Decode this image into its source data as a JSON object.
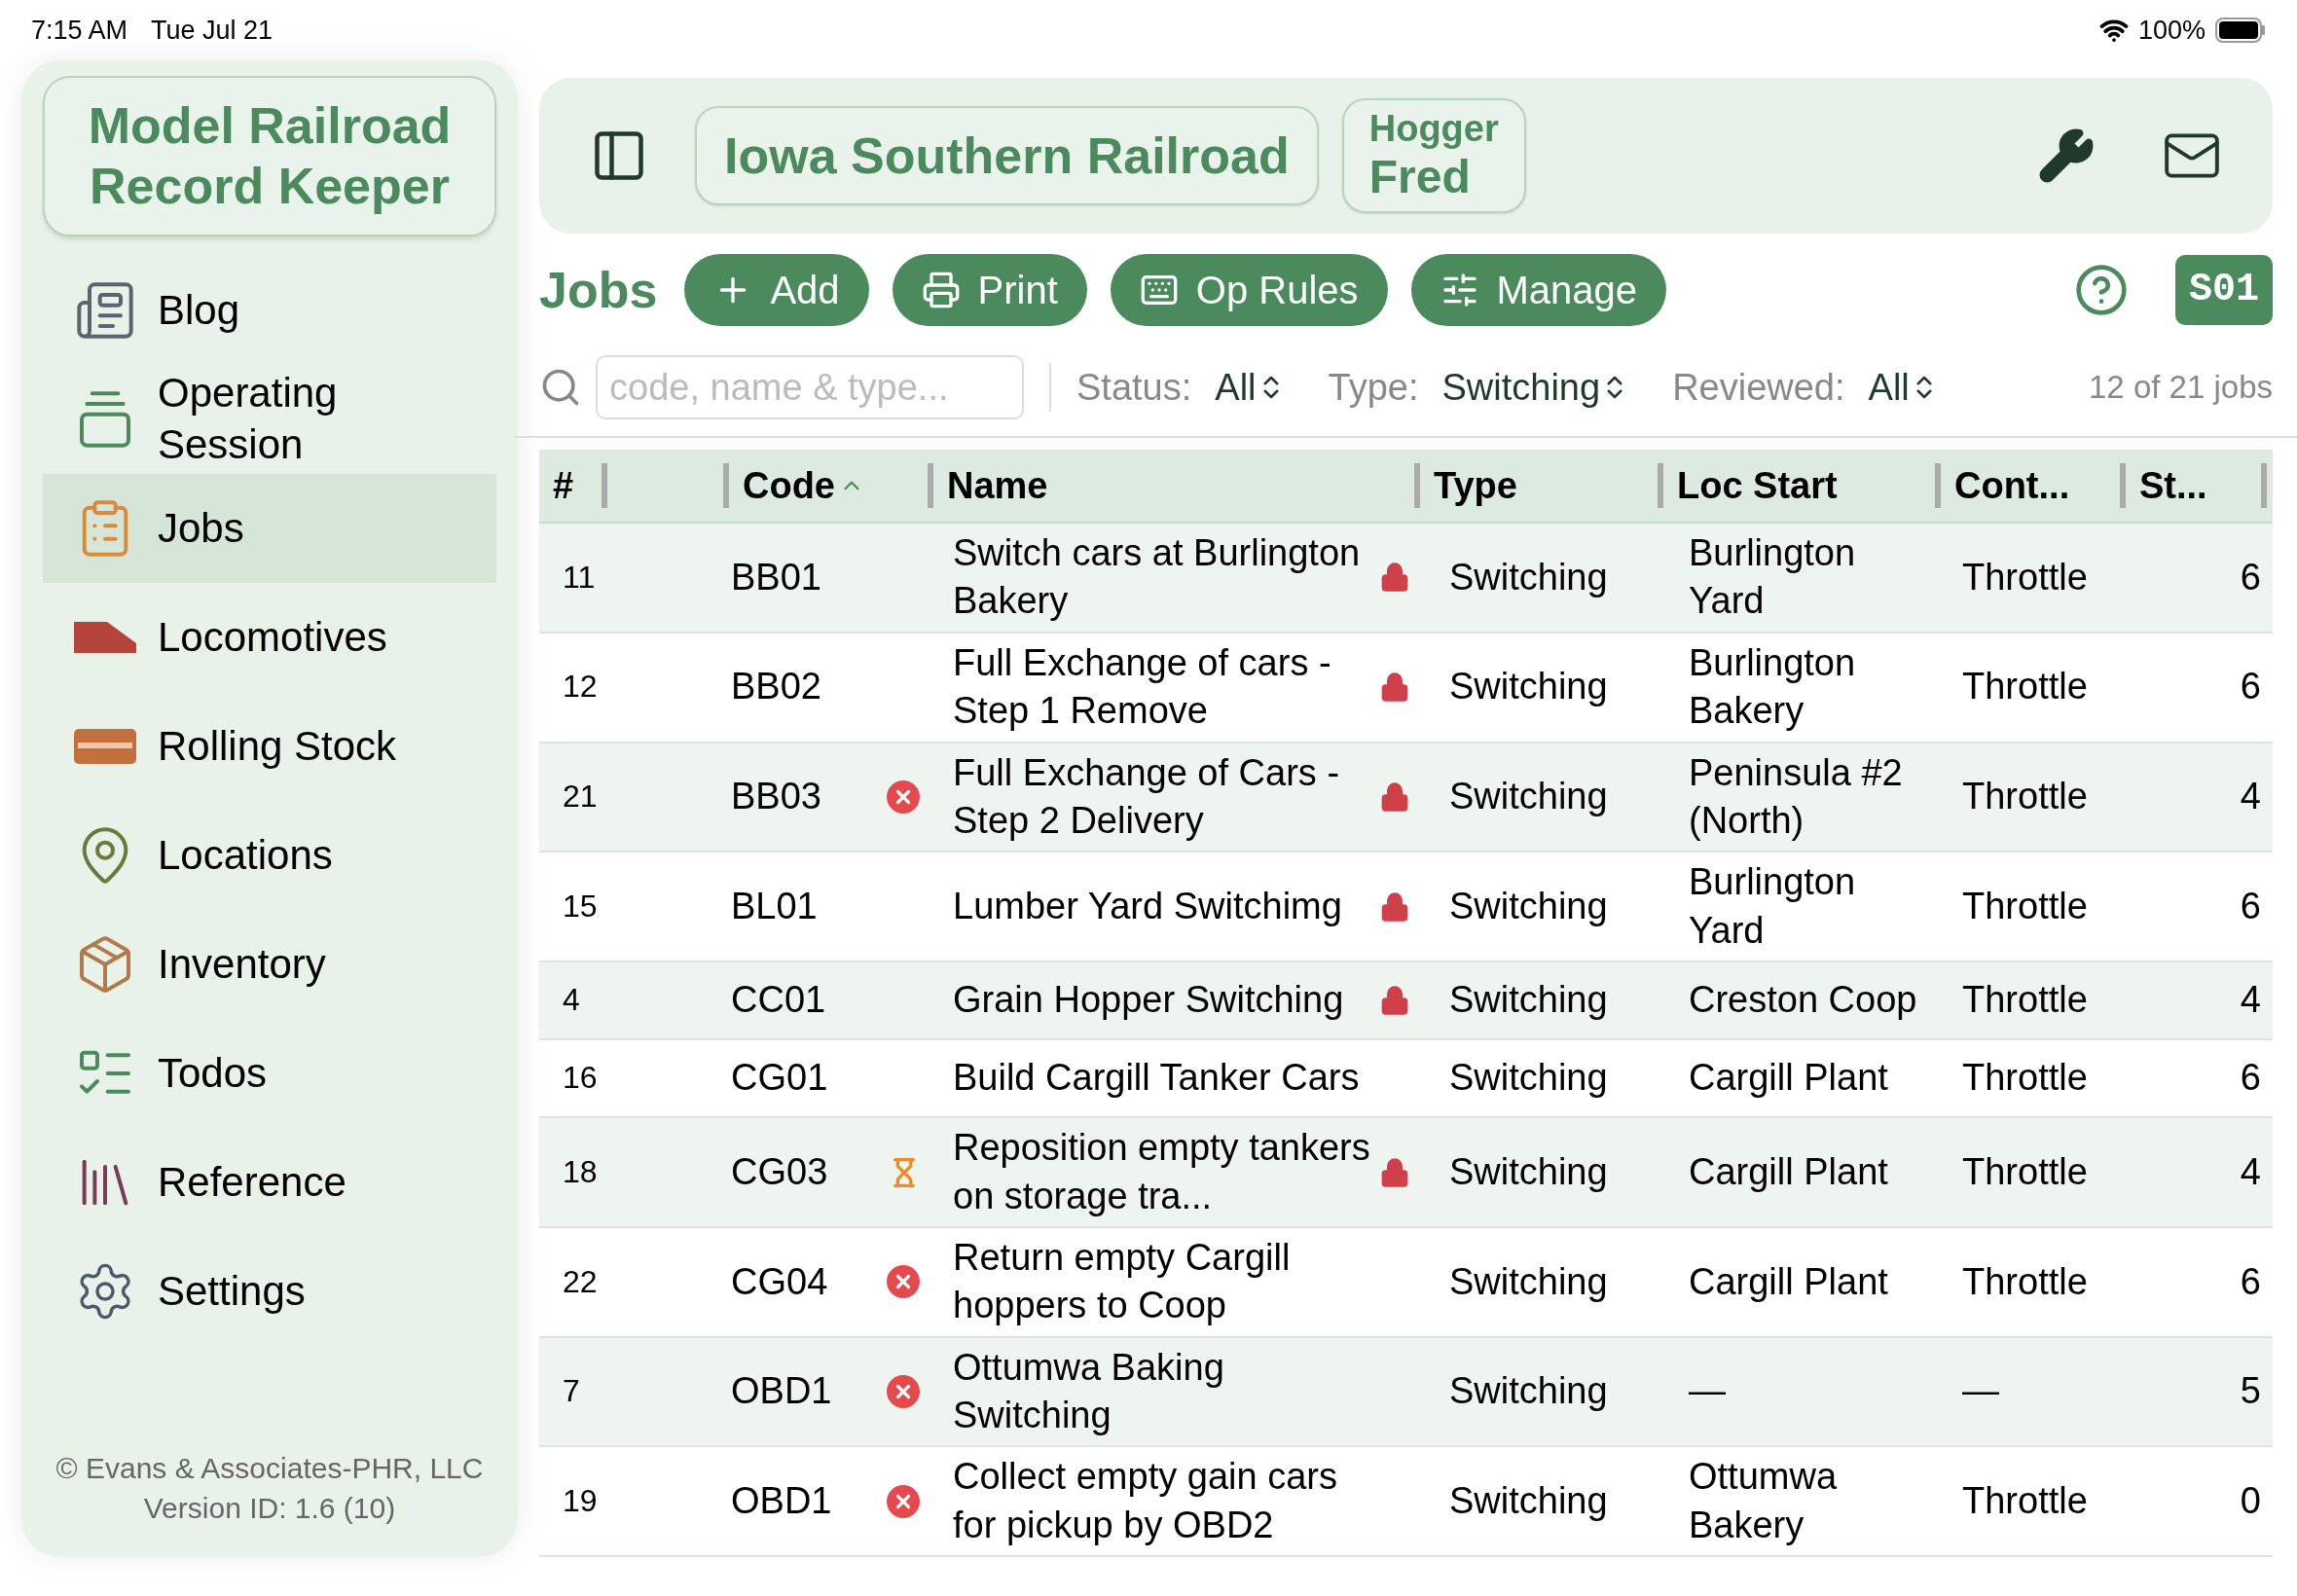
{
  "status_bar": {
    "time": "7:15 AM",
    "date": "Tue Jul 21",
    "battery": "100%"
  },
  "app_title": {
    "line1": "Model Railroad",
    "line2": "Record Keeper"
  },
  "sidebar": {
    "items": [
      {
        "label": "Blog",
        "selected": false
      },
      {
        "label": "Operating Session",
        "selected": false
      },
      {
        "label": "Jobs",
        "selected": true
      },
      {
        "label": "Locomotives",
        "selected": false
      },
      {
        "label": "Rolling Stock",
        "selected": false
      },
      {
        "label": "Locations",
        "selected": false
      },
      {
        "label": "Inventory",
        "selected": false
      },
      {
        "label": "Todos",
        "selected": false
      },
      {
        "label": "Reference",
        "selected": false
      },
      {
        "label": "Settings",
        "selected": false
      }
    ],
    "footer": [
      "© Evans & Associates-PHR, LLC",
      "Version ID: 1.6 (10)"
    ]
  },
  "header": {
    "railroad": "Iowa Southern Railroad",
    "role": "Hogger",
    "user": "Fred"
  },
  "toolbar": {
    "title": "Jobs",
    "buttons": [
      {
        "label": "Add"
      },
      {
        "label": "Print"
      },
      {
        "label": "Op Rules"
      },
      {
        "label": "Manage"
      }
    ],
    "session_badge": "S01"
  },
  "filters": {
    "search_placeholder": "code, name & type...",
    "status_label": "Status:",
    "status_value": "All",
    "type_label": "Type:",
    "type_value": "Switching",
    "reviewed_label": "Reviewed:",
    "reviewed_value": "All",
    "count": "12 of 21 jobs"
  },
  "table": {
    "columns": [
      "#",
      "",
      "Code",
      "Name",
      "Type",
      "Loc Start",
      "Cont...",
      "St..."
    ],
    "rows": [
      {
        "num": "11",
        "code": "BB01",
        "error": false,
        "pending": false,
        "name": "Switch cars at Burlington Bakery",
        "locked": true,
        "type": "Switching",
        "loc_start": "Burlington Yard",
        "control": "Throttle",
        "column_8": "6"
      },
      {
        "num": "12",
        "code": "BB02",
        "error": false,
        "pending": false,
        "name": "Full Exchange of cars - Step 1 Remove",
        "locked": true,
        "type": "Switching",
        "loc_start": "Burlington Bakery",
        "control": "Throttle",
        "column_8": "6"
      },
      {
        "num": "21",
        "code": "BB03",
        "error": true,
        "pending": false,
        "name": "Full Exchange of Cars - Step 2 Delivery",
        "locked": true,
        "type": "Switching",
        "loc_start": "Peninsula #2 (North)",
        "control": "Throttle",
        "column_8": "4"
      },
      {
        "num": "15",
        "code": "BL01",
        "error": false,
        "pending": false,
        "name": "Lumber Yard Switchimg",
        "locked": true,
        "type": "Switching",
        "loc_start": "Burlington Yard",
        "control": "Throttle",
        "column_8": "6"
      },
      {
        "num": "4",
        "code": "CC01",
        "error": false,
        "pending": false,
        "name": "Grain Hopper Switching",
        "locked": true,
        "type": "Switching",
        "loc_start": "Creston Coop",
        "control": "Throttle",
        "column_8": "4"
      },
      {
        "num": "16",
        "code": "CG01",
        "error": false,
        "pending": false,
        "name": "Build Cargill Tanker Cars",
        "locked": false,
        "type": "Switching",
        "loc_start": "Cargill Plant",
        "control": "Throttle",
        "column_8": "6"
      },
      {
        "num": "18",
        "code": "CG03",
        "error": false,
        "pending": true,
        "name": "Reposition empty tankers on storage tra...",
        "locked": true,
        "type": "Switching",
        "loc_start": "Cargill Plant",
        "control": "Throttle",
        "column_8": "4"
      },
      {
        "num": "22",
        "code": "CG04",
        "error": true,
        "pending": false,
        "name": "Return empty Cargill hoppers to Coop",
        "locked": false,
        "type": "Switching",
        "loc_start": "Cargill Plant",
        "control": "Throttle",
        "column_8": "6"
      },
      {
        "num": "7",
        "code": "OBD1",
        "error": true,
        "pending": false,
        "name": "Ottumwa Baking Switching",
        "locked": false,
        "type": "Switching",
        "loc_start": "—",
        "control": "—",
        "column_8": "5"
      },
      {
        "num": "19",
        "code": "OBD1",
        "error": true,
        "pending": false,
        "name": "Collect empty gain cars for pickup by OBD2",
        "locked": false,
        "type": "Switching",
        "loc_start": "Ottumwa Bakery",
        "control": "Throttle",
        "column_8": "0"
      }
    ]
  }
}
